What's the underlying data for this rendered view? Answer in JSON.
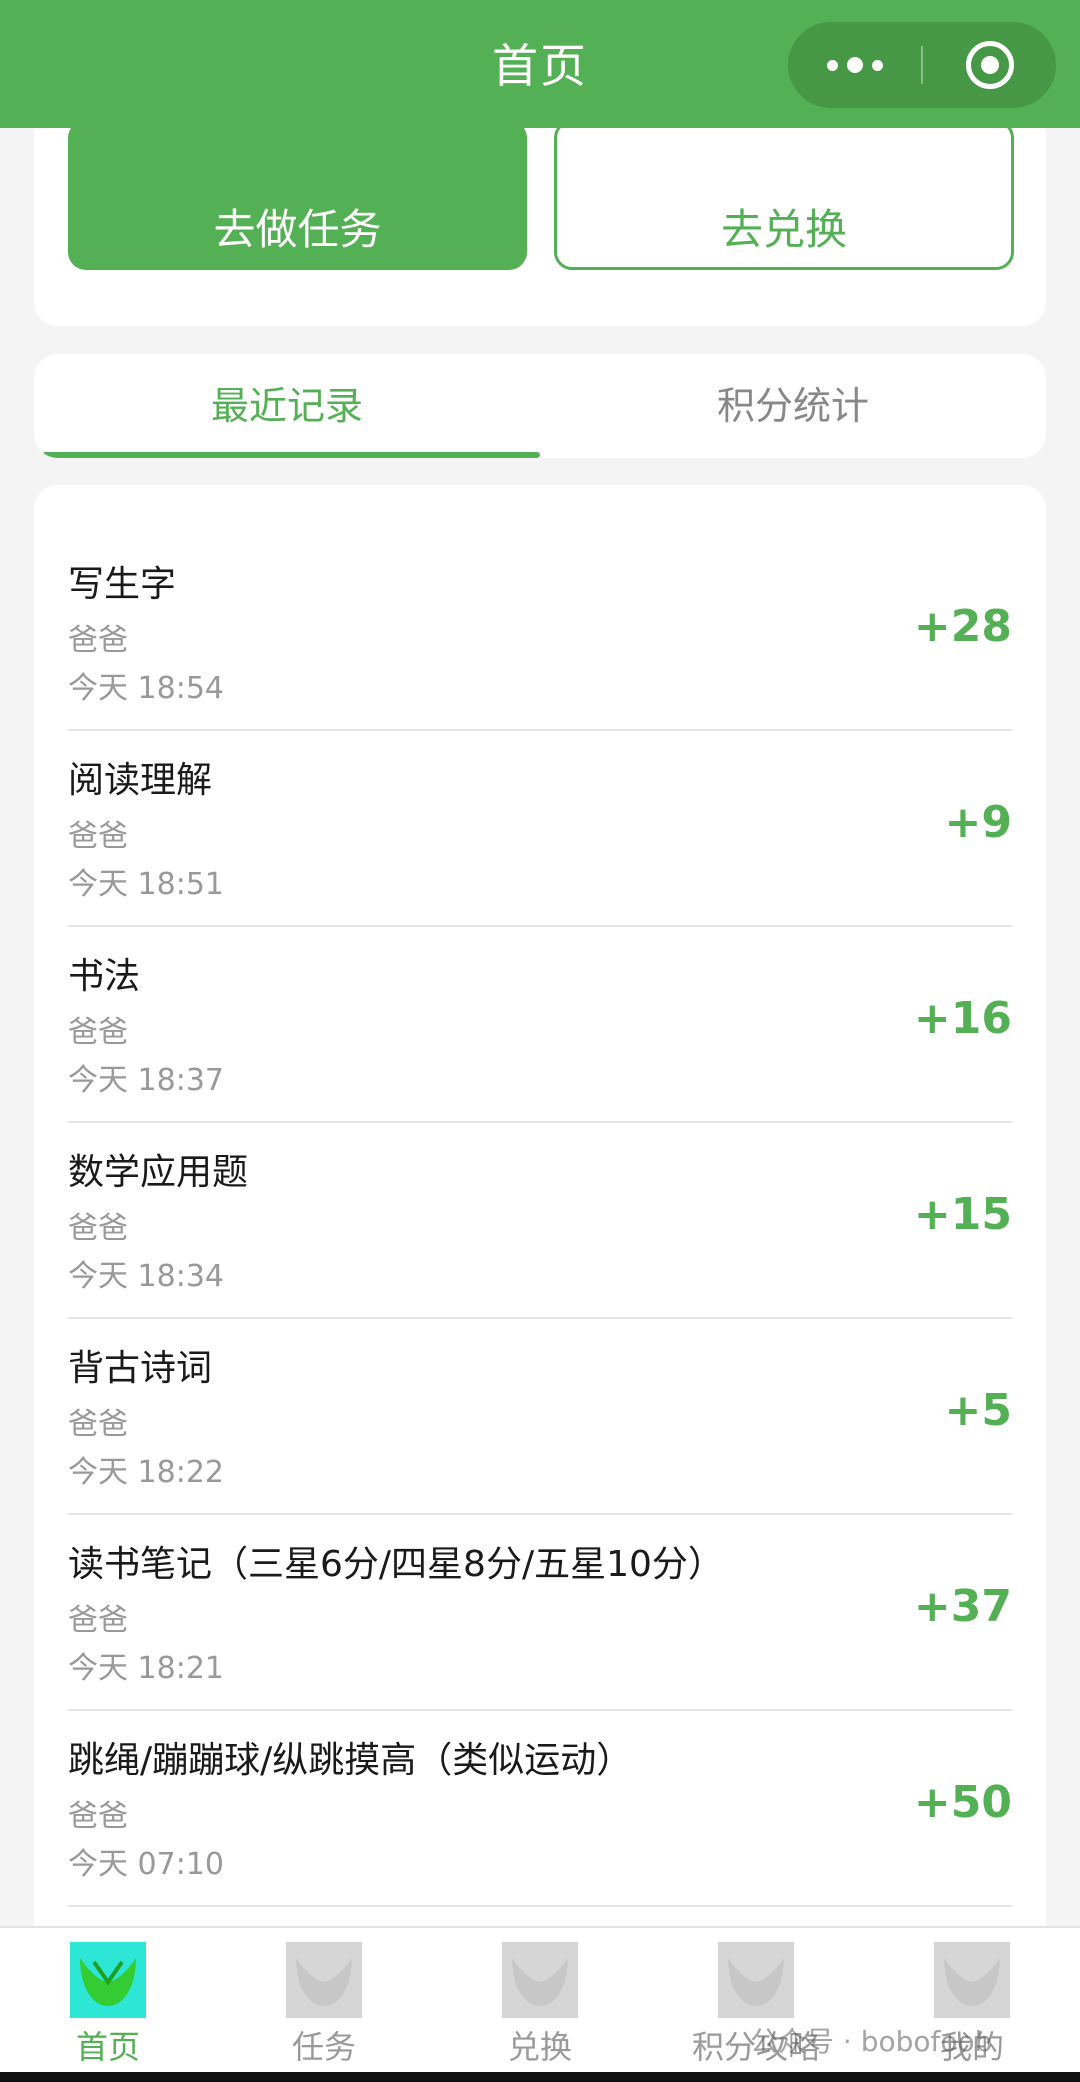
{
  "header": {
    "title": "首页"
  },
  "actions": {
    "task_label": "去做任务",
    "exchange_label": "去兑换"
  },
  "tabs": [
    {
      "label": "最近记录",
      "active": true
    },
    {
      "label": "积分统计",
      "active": false
    }
  ],
  "records": [
    {
      "name": "写生字",
      "by": "爸爸",
      "time": "今天 18:54",
      "points": "+28"
    },
    {
      "name": "阅读理解",
      "by": "爸爸",
      "time": "今天 18:51",
      "points": "+9"
    },
    {
      "name": "书法",
      "by": "爸爸",
      "time": "今天 18:37",
      "points": "+16"
    },
    {
      "name": "数学应用题",
      "by": "爸爸",
      "time": "今天 18:34",
      "points": "+15"
    },
    {
      "name": "背古诗词",
      "by": "爸爸",
      "time": "今天 18:22",
      "points": "+5"
    },
    {
      "name": "读书笔记（三星6分/四星8分/五星10分）",
      "by": "爸爸",
      "time": "今天 18:21",
      "points": "+37"
    },
    {
      "name": "跳绳/蹦蹦球/纵跳摸高（类似运动）",
      "by": "爸爸",
      "time": "今天 07:10",
      "points": "+50"
    }
  ],
  "nav": [
    {
      "label": "首页",
      "icon": "home-icon",
      "active": true
    },
    {
      "label": "任务",
      "icon": "task-icon",
      "active": false
    },
    {
      "label": "兑换",
      "icon": "exchange-icon",
      "active": false
    },
    {
      "label": "积分攻略",
      "icon": "points-guide-icon",
      "active": false
    },
    {
      "label": "我的",
      "icon": "profile-icon",
      "active": false
    }
  ],
  "watermark": "公众号 · bobofoob",
  "colors": {
    "primary": "#54b054",
    "muted": "#999999"
  }
}
